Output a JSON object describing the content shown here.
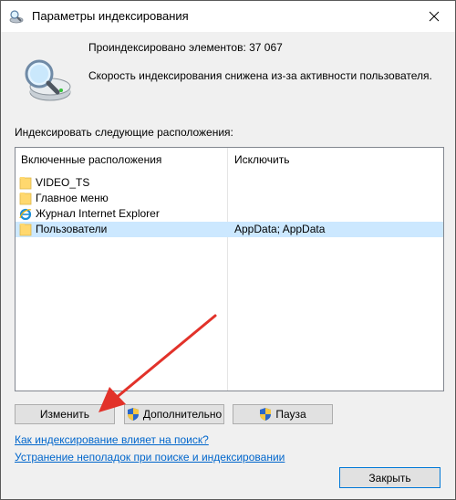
{
  "window": {
    "title": "Параметры индексирования"
  },
  "summary": {
    "indexed_count": "Проиндексировано элементов: 37 067",
    "speed_status": "Скорость индексирования снижена из-за активности пользователя."
  },
  "locations": {
    "label": "Индексировать следующие расположения:",
    "columns": [
      "Включенные расположения",
      "Исключить"
    ],
    "rows": [
      {
        "icon": "folder-icon",
        "name": "VIDEO_TS",
        "exclude": ""
      },
      {
        "icon": "folder-icon",
        "name": "Главное меню",
        "exclude": ""
      },
      {
        "icon": "internet-explorer-icon",
        "name": "Журнал Internet Explorer",
        "exclude": ""
      },
      {
        "icon": "folder-icon",
        "name": "Пользователи",
        "exclude": "AppData; AppData"
      }
    ],
    "selected_row": 3
  },
  "buttons": {
    "change": "Изменить",
    "advanced": "Дополнительно",
    "pause": "Пауза",
    "close": "Закрыть"
  },
  "links": {
    "how_affects": "Как индексирование влияет на поиск?",
    "troubleshoot": "Устранение неполадок при поиске и индексировании"
  },
  "colors": {
    "selection": "#cce8ff",
    "link": "#0066cc",
    "arrow": "#e2322a",
    "default_button_border": "#0078d7"
  }
}
